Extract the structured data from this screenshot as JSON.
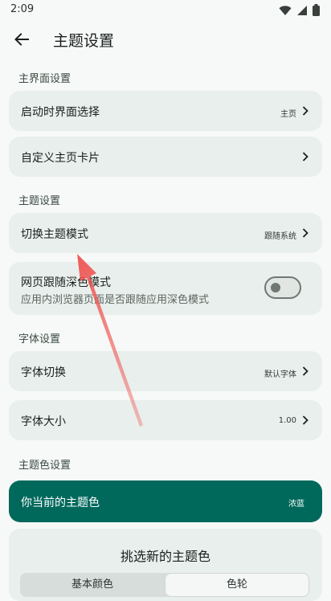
{
  "status_bar": {
    "time": "2:09"
  },
  "appbar": {
    "title": "主题设置"
  },
  "sections": {
    "main_ui": "主界面设置",
    "theme": "主题设置",
    "font": "字体设置",
    "theme_color": "主题色设置"
  },
  "items": {
    "startup_page": {
      "label": "启动时界面选择",
      "value": "主页"
    },
    "custom_cards": {
      "label": "自定义主页卡片"
    },
    "theme_mode": {
      "label": "切换主题模式",
      "value": "跟随系统"
    },
    "web_dark": {
      "label": "网页跟随深色模式",
      "subtitle": "应用内浏览器页面是否跟随应用深色模式",
      "enabled": false
    },
    "font_switch": {
      "label": "字体切换",
      "value": "默认字体"
    },
    "font_size": {
      "label": "字体大小",
      "value": "1.00"
    }
  },
  "current_theme": {
    "label": "你当前的主题色",
    "value": "浓蓝",
    "color": "#00695c"
  },
  "picker": {
    "title": "挑选新的主题色",
    "tab_basic": "基本颜色",
    "tab_wheel": "色轮"
  },
  "annotation": {
    "arrow_color": "#ef5350"
  }
}
